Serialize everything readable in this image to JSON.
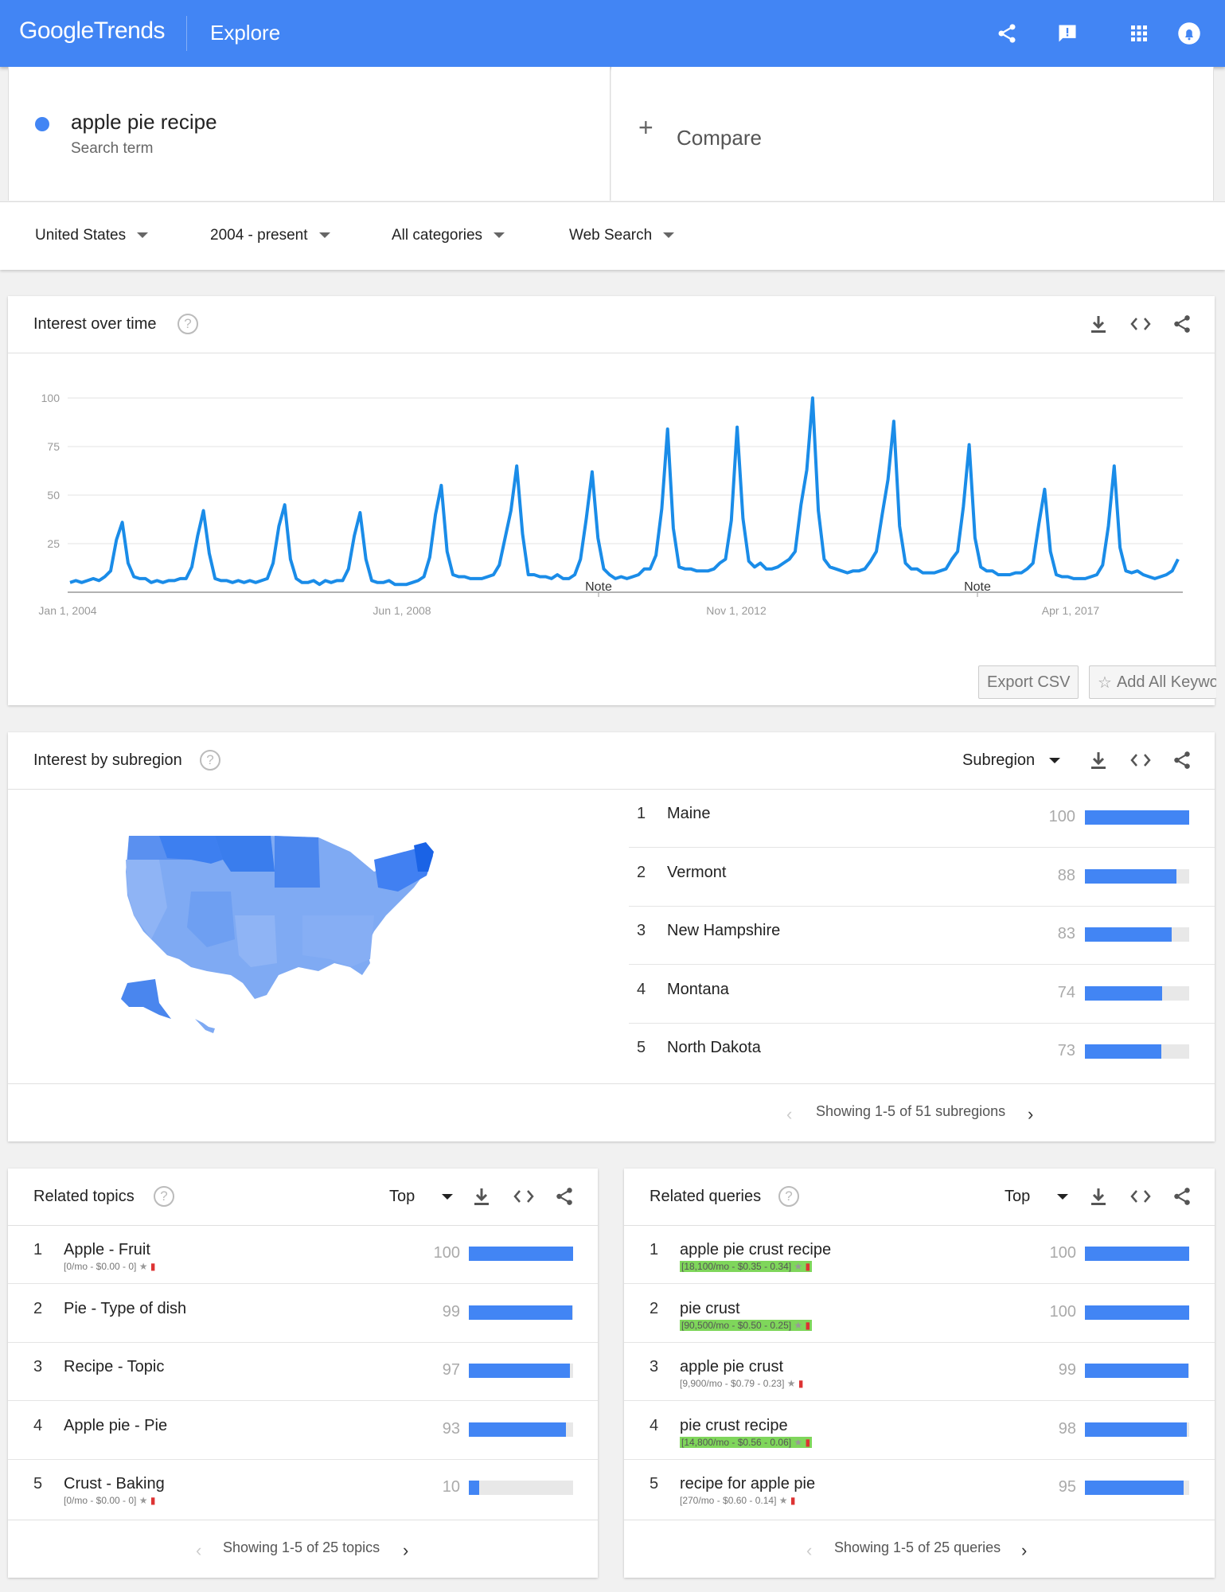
{
  "header": {
    "logo_google": "Google",
    "logo_trends": "Trends",
    "explore": "Explore",
    "icons": [
      "share-icon",
      "feedback-icon",
      "apps-icon",
      "notifications-icon"
    ]
  },
  "search": {
    "term": "apple pie recipe",
    "term_type": "Search term",
    "compare_label": "Compare",
    "term_color": "#4285f4"
  },
  "filters": {
    "location": "United States",
    "time": "2004 - present",
    "category": "All categories",
    "search_type": "Web Search"
  },
  "interest_over_time": {
    "title": "Interest over time",
    "export_label": "Export CSV",
    "add_keywords_label": "Add All Keywo",
    "note_label": "Note",
    "chart_data": {
      "type": "line",
      "ylim": [
        0,
        100
      ],
      "y_ticks": [
        "100",
        "75",
        "50",
        "25"
      ],
      "x_ticks": [
        "Jan 1, 2004",
        "Jun 1, 2008",
        "Nov 1, 2012",
        "Apr 1, 2017"
      ],
      "grid": true,
      "line_color": "#1a8ce8",
      "series": [
        {
          "values": [
            5,
            6,
            5,
            6,
            7,
            6,
            8,
            11,
            27,
            36,
            15,
            8,
            7,
            7,
            5,
            6,
            5,
            6,
            6,
            7,
            7,
            13,
            29,
            42,
            20,
            7,
            6,
            6,
            5,
            6,
            5,
            6,
            5,
            6,
            7,
            15,
            34,
            45,
            17,
            7,
            5,
            5,
            6,
            4,
            6,
            5,
            6,
            6,
            12,
            29,
            41,
            17,
            6,
            5,
            5,
            6,
            4,
            4,
            4,
            5,
            6,
            8,
            18,
            40,
            55,
            21,
            9,
            8,
            8,
            7,
            7,
            7,
            8,
            9,
            14,
            28,
            42,
            65,
            30,
            9,
            9,
            8,
            8,
            7,
            9,
            7,
            7,
            9,
            17,
            38,
            62,
            28,
            12,
            9,
            7,
            8,
            7,
            8,
            9,
            12,
            12,
            19,
            43,
            84,
            33,
            13,
            12,
            12,
            11,
            11,
            11,
            12,
            15,
            17,
            37,
            85,
            38,
            16,
            13,
            15,
            12,
            12,
            13,
            15,
            17,
            21,
            45,
            63,
            100,
            42,
            17,
            13,
            12,
            11,
            10,
            11,
            11,
            12,
            16,
            21,
            40,
            58,
            88,
            34,
            15,
            12,
            12,
            10,
            10,
            10,
            11,
            12,
            17,
            21,
            44,
            76,
            28,
            13,
            11,
            11,
            9,
            9,
            9,
            10,
            10,
            12,
            15,
            35,
            53,
            21,
            9,
            8,
            8,
            7,
            7,
            7,
            8,
            9,
            14,
            34,
            65,
            23,
            11,
            10,
            11,
            9,
            8,
            7,
            8,
            9,
            11,
            17
          ]
        }
      ]
    }
  },
  "interest_by_subregion": {
    "title": "Interest by subregion",
    "selector": "Subregion",
    "rows": [
      {
        "rank": "1",
        "name": "Maine",
        "value": "100",
        "pct": 100
      },
      {
        "rank": "2",
        "name": "Vermont",
        "value": "88",
        "pct": 88
      },
      {
        "rank": "3",
        "name": "New Hampshire",
        "value": "83",
        "pct": 83
      },
      {
        "rank": "4",
        "name": "Montana",
        "value": "74",
        "pct": 74
      },
      {
        "rank": "5",
        "name": "North Dakota",
        "value": "73",
        "pct": 73
      }
    ],
    "pager": "Showing 1-5 of 51 subregions"
  },
  "related_topics": {
    "title": "Related topics",
    "selector": "Top",
    "rows": [
      {
        "rank": "1",
        "name": "Apple - Fruit",
        "value": "100",
        "pct": 100,
        "sub": "[0/mo - $0.00 - 0]",
        "hl": false
      },
      {
        "rank": "2",
        "name": "Pie - Type of dish",
        "value": "99",
        "pct": 99,
        "sub": "",
        "hl": false
      },
      {
        "rank": "3",
        "name": "Recipe - Topic",
        "value": "97",
        "pct": 97,
        "sub": "",
        "hl": false
      },
      {
        "rank": "4",
        "name": "Apple pie - Pie",
        "value": "93",
        "pct": 93,
        "sub": "",
        "hl": false
      },
      {
        "rank": "5",
        "name": "Crust - Baking",
        "value": "10",
        "pct": 10,
        "sub": "[0/mo - $0.00 - 0]",
        "hl": false
      }
    ],
    "pager": "Showing 1-5 of 25 topics"
  },
  "related_queries": {
    "title": "Related queries",
    "selector": "Top",
    "rows": [
      {
        "rank": "1",
        "name": "apple pie crust recipe",
        "value": "100",
        "pct": 100,
        "sub": "[18,100/mo - $0.35 - 0.34]",
        "hl": true
      },
      {
        "rank": "2",
        "name": "pie crust",
        "value": "100",
        "pct": 100,
        "sub": "[90,500/mo - $0.50 - 0.25]",
        "hl": true
      },
      {
        "rank": "3",
        "name": "apple pie crust",
        "value": "99",
        "pct": 99,
        "sub": "[9,900/mo - $0.79 - 0.23]",
        "hl": false
      },
      {
        "rank": "4",
        "name": "pie crust recipe",
        "value": "98",
        "pct": 98,
        "sub": "[14,800/mo - $0.56 - 0.06]",
        "hl": true
      },
      {
        "rank": "5",
        "name": "recipe for apple pie",
        "value": "95",
        "pct": 95,
        "sub": "[270/mo - $0.60 - 0.14]",
        "hl": false
      }
    ],
    "pager": "Showing 1-5 of 25 queries"
  }
}
